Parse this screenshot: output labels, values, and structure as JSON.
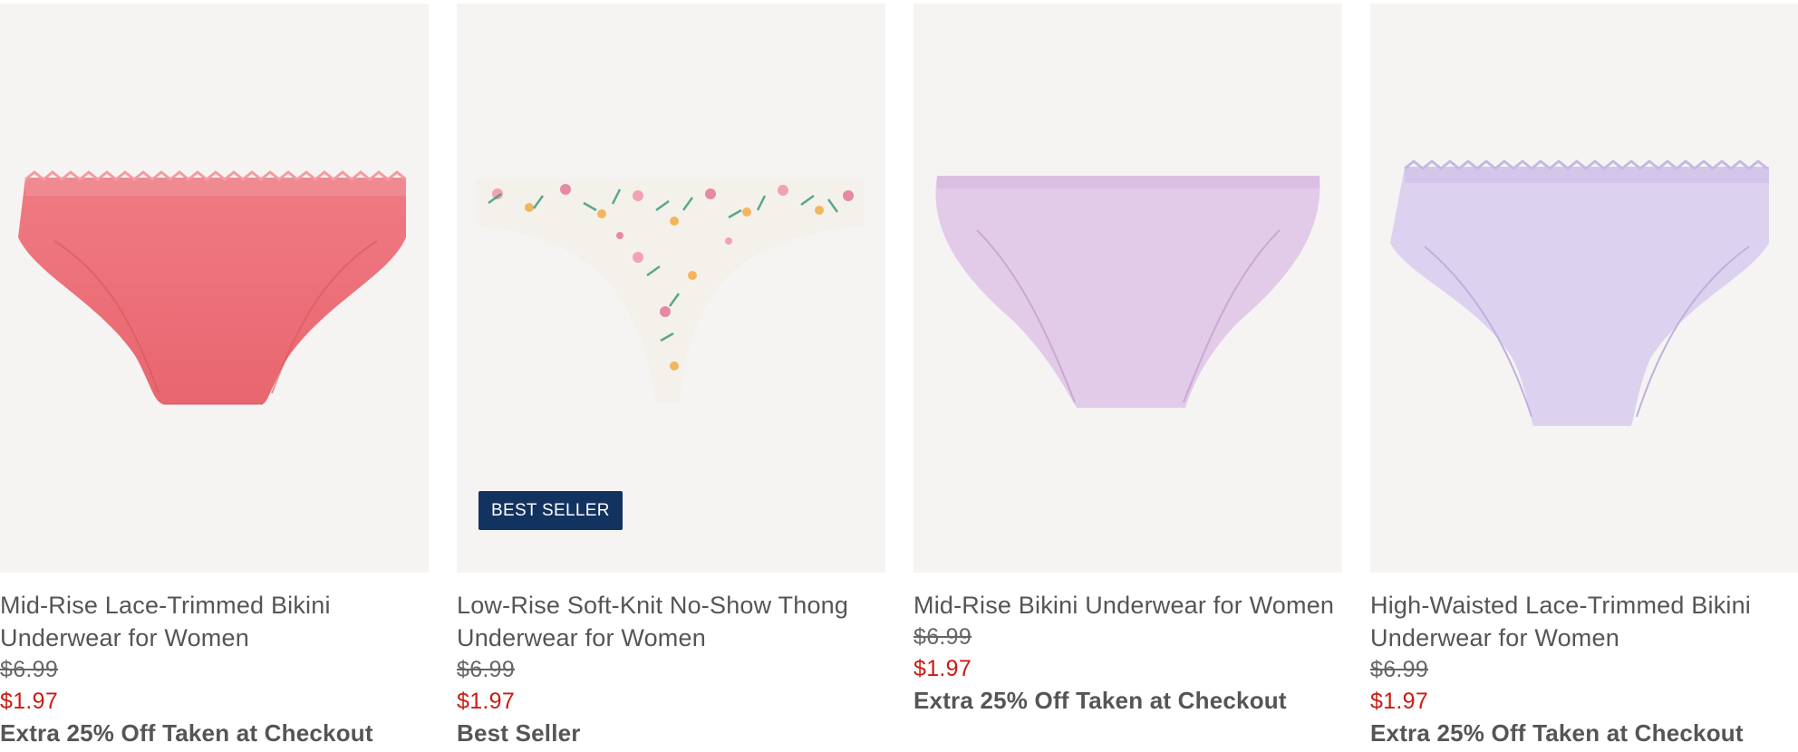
{
  "products": [
    {
      "title": "Mid-Rise Lace-Trimmed Bikini Underwear for Women",
      "price_original": "$6.99",
      "price_sale": "$1.97",
      "promo": "Extra 25% Off Taken at Checkout",
      "color": "#ec737b",
      "image_icon": "bikini-underwear-pink-image"
    },
    {
      "title": "Low-Rise Soft-Knit No-Show Thong Underwear for Women",
      "price_original": "$6.99",
      "price_sale": "$1.97",
      "promo": "Best Seller",
      "badge": "BEST SELLER",
      "color": "#f4f1ea",
      "image_icon": "thong-underwear-floral-image"
    },
    {
      "title": "Mid-Rise Bikini Underwear for Women",
      "price_original": "$6.99",
      "price_sale": "$1.97",
      "promo": "Extra 25% Off Taken at Checkout",
      "color": "#e2cbe9",
      "image_icon": "bikini-underwear-lilac-image"
    },
    {
      "title": "High-Waisted Lace-Trimmed Bikini Underwear for Women",
      "price_original": "$6.99",
      "price_sale": "$1.97",
      "promo": "Extra 25% Off Taken at Checkout",
      "color": "#dcd2ef",
      "image_icon": "bikini-underwear-lavender-image"
    }
  ],
  "colors": {
    "image_bg": "#f5f4f3",
    "sale_price": "#cc1b12",
    "badge_bg": "#12325f",
    "text": "#555555"
  }
}
